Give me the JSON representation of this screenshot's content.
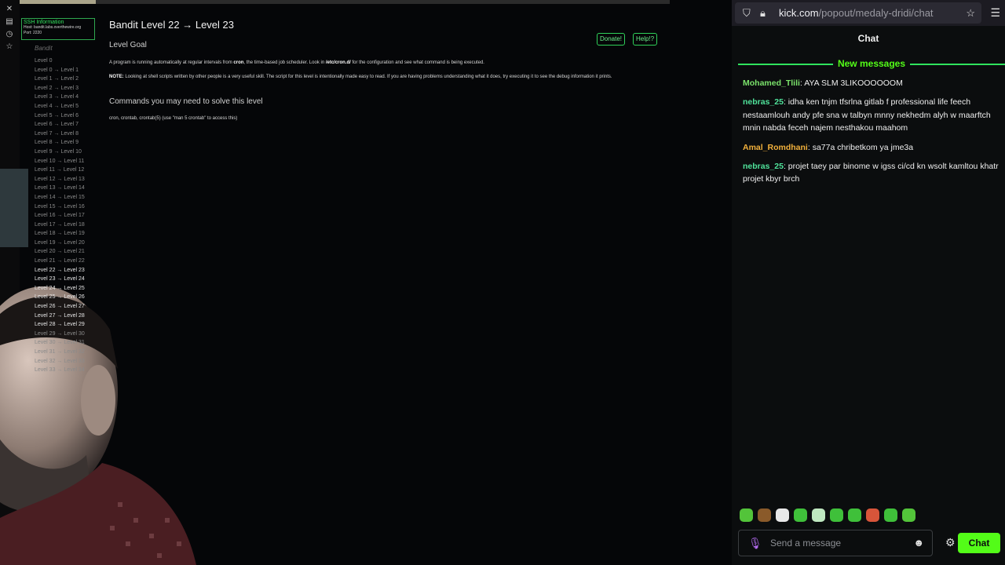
{
  "overlay": {
    "ssh_box": {
      "title": "SSH Information",
      "host_line": "Host: bandit.labs.overthewire.org",
      "port_line": "Port: 2220"
    },
    "brand": "Bandit",
    "levels": [
      "Level 0",
      "Level 0 → Level 1",
      "Level 1 → Level 2",
      "Level 2 → Level 3",
      "Level 3 → Level 4",
      "Level 4 → Level 5",
      "Level 5 → Level 6",
      "Level 6 → Level 7",
      "Level 7 → Level 8",
      "Level 8 → Level 9",
      "Level 9 → Level 10",
      "Level 10 → Level 11",
      "Level 11 → Level 12",
      "Level 12 → Level 13",
      "Level 13 → Level 14",
      "Level 14 → Level 15",
      "Level 15 → Level 16",
      "Level 16 → Level 17",
      "Level 17 → Level 18",
      "Level 18 → Level 19",
      "Level 19 → Level 20",
      "Level 20 → Level 21",
      "Level 21 → Level 22",
      "Level 22 → Level 23",
      "Level 23 → Level 24",
      "Level 24 → Level 25",
      "Level 25 → Level 26",
      "Level 26 → Level 27",
      "Level 27 → Level 28",
      "Level 28 → Level 29",
      "Level 29 → Level 30",
      "Level 30 → Level 31",
      "Level 31 → Level 32",
      "Level 32 → Level 33",
      "Level 33 → Level 34"
    ],
    "page_title": "Bandit Level 22 → Level 23",
    "goal_heading": "Level Goal",
    "donate_label": "Donate!",
    "help_label": "Help!?",
    "goal_text_1": "A program is running automatically at regular intervals from ",
    "goal_text_cron": "cron",
    "goal_text_2": ", the time-based job scheduler. Look in ",
    "goal_text_path": "/etc/cron.d/",
    "goal_text_3": " for the configuration and see what command is being executed.",
    "note_label": "NOTE:",
    "note_text": " Looking at shell scripts written by other people is a very useful skill. The script for this level is intentionally made easy to read. If you are having problems understanding what it does, try executing it to see the debug information it prints.",
    "cmd_heading": "Commands you may need to solve this level",
    "cmd_text": "cron, crontab, crontab(5) (use \"man 5 crontab\" to access this)"
  },
  "browser": {
    "url_host": "kick.com",
    "url_path": "/popout/medaly-dridi/chat",
    "shield_icon": "shield-icon",
    "lock_icon": "lock-icon",
    "star_icon": "star-icon",
    "menu_icon": "hamburger-menu-icon"
  },
  "chat": {
    "title": "Chat",
    "new_messages_label": "New messages",
    "messages": [
      {
        "user": "Mohamed_Tlili",
        "color": "#7be36b",
        "text": "AYA SLM 3LIKOOOOOOM"
      },
      {
        "user": "nebras_25",
        "color": "#4fe29a",
        "text": "idha ken tnjm tfsrlna gitlab f professional life feech nestaamlouh andy pfe sna w talbyn mnny nekhedm alyh w maarftch mnin nabda feceh najem nesthakou maahom"
      },
      {
        "user": "Amal_Romdhani",
        "color": "#f2b13c",
        "text": "sa77a chribetkom ya jme3a"
      },
      {
        "user": "nebras_25",
        "color": "#4fe29a",
        "text": "projet taey par binome w igss ci/cd kn wsolt kamltou khatr projet kbyr brch"
      }
    ],
    "emote_colors": [
      "#53c43a",
      "#8a5a2a",
      "#e8e8e8",
      "#3fc03a",
      "#bfe8c0",
      "#3fc03a",
      "#3fc03a",
      "#d8553a",
      "#3fc03a",
      "#53c43a"
    ],
    "input_placeholder": "Send a message",
    "send_label": "Chat",
    "accent": "#53fc18"
  }
}
